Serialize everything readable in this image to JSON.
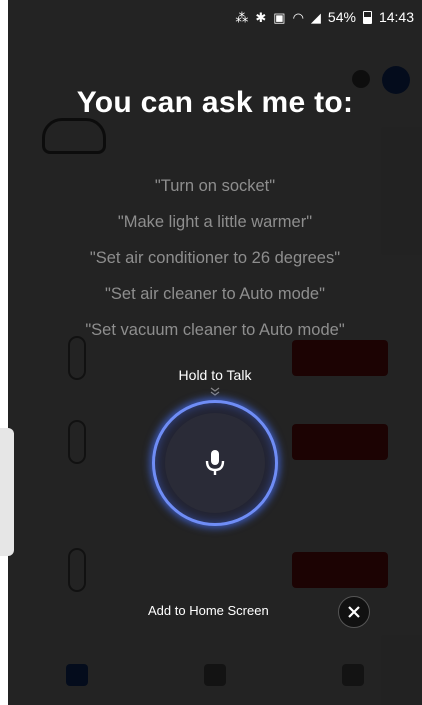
{
  "status_bar": {
    "icons": [
      "nfc-icon",
      "bluetooth-icon",
      "mute-icon",
      "wifi-icon",
      "signal-icon"
    ],
    "battery": "54%",
    "time": "14:43"
  },
  "assistant": {
    "headline": "You can ask me to:",
    "suggestions": [
      "\"Turn on socket\"",
      "\"Make light a little warmer\"",
      "\"Set air conditioner to 26 degrees\"",
      "\"Set air cleaner to Auto mode\"",
      "\"Set vacuum cleaner to Auto mode\""
    ],
    "hold_to_talk": "Hold to Talk",
    "add_to_home": "Add to Home Screen"
  },
  "colors": {
    "accent_ring": "#6f8df6",
    "app_red": "#c21818",
    "app_blue": "#1e57c8"
  }
}
